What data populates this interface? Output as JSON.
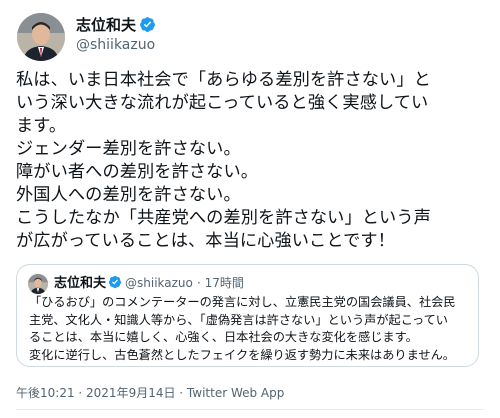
{
  "author": {
    "name": "志位和夫",
    "handle": "@shiikazuo",
    "verified_color": "#1d9bf0"
  },
  "tweet": {
    "lines": [
      "私は、いま日本社会で「あらゆる差別を許さない」と",
      "いう深い大きな流れが起こっていると強く実感してい",
      "ます。",
      "ジェンダー差別を許さない。",
      "障がい者への差別を許さない。",
      "外国人への差別を許さない。",
      "こうしたなか「共産党への差別を許さない」という声",
      "が広がっていることは、本当に心強いことです！"
    ]
  },
  "quote": {
    "name": "志位和夫",
    "handle": "@shiikazuo",
    "time": "· 17時間",
    "lines": [
      "「ひるおび」のコメンテーターの発言に対し、立憲民主党の国会議員、社会民",
      "主党、文化人・知識人等から、「虚偽発言は許さない」という声が起こってい",
      "ることは、本当に嬉しく、心強く、日本社会の大きな変化を感じます。",
      "変化に逆行し、古色蒼然としたフェイクを繰り返す勢力に未来はありません。"
    ]
  },
  "footer": {
    "timestamp": "午後10:21 · 2021年9月14日 · Twitter Web App"
  }
}
